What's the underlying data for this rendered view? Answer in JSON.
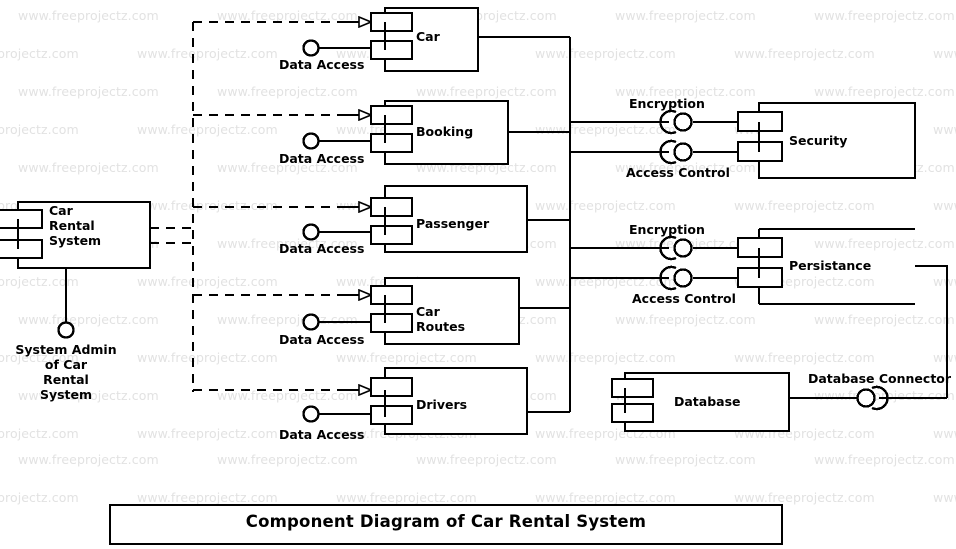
{
  "diagram": {
    "title": "Component Diagram of Car Rental System",
    "watermark_text": "www.freeprojectz.com",
    "line_color": "#000000",
    "watermark_color": "#e2e2e2",
    "background_color": "#ffffff",
    "type": "uml-component-diagram"
  },
  "system_component": {
    "label": "Car\nRental\nSystem"
  },
  "actor": {
    "label": "System Admin\nof Car\nRental\nSystem"
  },
  "components": [
    {
      "label": "Car",
      "interface": "Data Access"
    },
    {
      "label": "Booking",
      "interface": "Data Access"
    },
    {
      "label": "Passenger",
      "interface": "Data Access"
    },
    {
      "label": "Car\nRoutes",
      "interface": "Data Access"
    },
    {
      "label": "Drivers",
      "interface": "Data Access"
    }
  ],
  "service_components": [
    {
      "label": "Security",
      "provided": [
        "Encryption",
        "Access Control"
      ]
    },
    {
      "label": "Persistance",
      "provided": [
        "Encryption",
        "Access Control"
      ]
    }
  ],
  "database": {
    "label": "Database",
    "connector_label": "Database Connector"
  }
}
